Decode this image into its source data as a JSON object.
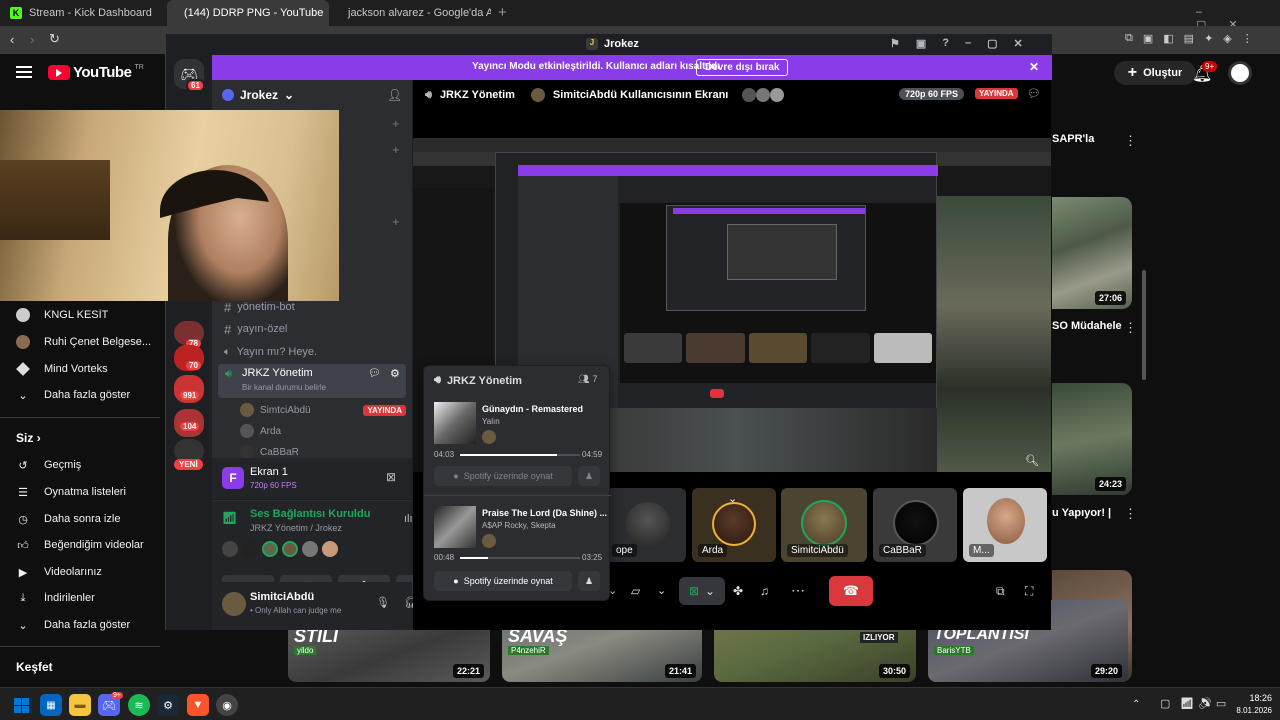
{
  "browser": {
    "tabs": [
      {
        "title": "Stream - Kick Dashboard",
        "favicon": "kick-icon",
        "color": "#53fc18"
      },
      {
        "title": "(144) DDRP PNG - YouTube",
        "favicon": "youtube-icon",
        "color": "#ff0033"
      },
      {
        "title": "jackson alvarez - Google'da Ara",
        "favicon": "google-icon",
        "color": "#4285f4"
      }
    ],
    "new_tab": "+"
  },
  "youtube": {
    "logo": "YouTube",
    "logo_region": "TR",
    "create_label": "Oluştur",
    "notifications": "9+",
    "sidebar": {
      "subscriptions": [
        {
          "label": "KNGL KESİT"
        },
        {
          "label": "Ruhi Çenet Belgese..."
        },
        {
          "label": "Mind Vorteks"
        }
      ],
      "show_more_1": "Daha fazla göster",
      "you_header": "Siz",
      "you_items": [
        {
          "label": "Geçmiş",
          "icon": "history-icon"
        },
        {
          "label": "Oynatma listeleri",
          "icon": "playlist-icon"
        },
        {
          "label": "Daha sonra izle",
          "icon": "clock-icon"
        },
        {
          "label": "Beğendiğim videolar",
          "icon": "thumbs-up-icon"
        },
        {
          "label": "Videolarınız",
          "icon": "play-square-icon"
        },
        {
          "label": "İndirilenler",
          "icon": "download-icon"
        }
      ],
      "show_more_2": "Daha fazla göster",
      "explore_header": "Keşfet"
    },
    "right_cards": {
      "title_1": "SAPR'la",
      "duration_1": "27:06",
      "title_2": "SO Müdahele",
      "duration_2": "24:23",
      "title_3": "u Yapıyor! |"
    },
    "bottom_videos": [
      {
        "title": "STILI",
        "channel": "yildo",
        "duration": "22:21"
      },
      {
        "title": "SAVAŞ",
        "channel": "P4nzehiR",
        "duration": "21:41"
      },
      {
        "title": "IZLIYOR",
        "channel": "",
        "duration": "30:50"
      },
      {
        "title": "TOPLANTISI",
        "channel": "BarisYTB",
        "duration": "29:20"
      }
    ]
  },
  "discord": {
    "window_title": "Jrokez",
    "server_badge": "61",
    "streamer_banner": "Yayıncı Modu etkinleştirildi. Kullanıcı adları kısaltıldı.",
    "streamer_button": "Devre dışı bırak",
    "server_name": "Jrokez",
    "server_badges": [
      "78",
      "70",
      "991",
      "104"
    ],
    "server_new": "YENİ",
    "channels": [
      {
        "name": "yönetim-bot",
        "type": "text"
      },
      {
        "name": "yayın-özel",
        "type": "text"
      },
      {
        "name": "Yayın mı? Heye.",
        "type": "voice"
      }
    ],
    "active_voice": {
      "name": "JRKZ Yönetim",
      "status": "Bir kanal durumu belirle"
    },
    "voice_users": [
      {
        "name": "SimtciAbdü",
        "badge": "YAYINDA"
      },
      {
        "name": "Arda"
      },
      {
        "name": "CaBBaR"
      }
    ],
    "stream_card": {
      "title": "Ekran 1",
      "quality": "720p 60 FPS"
    },
    "voice_status": {
      "title": "Ses Bağlantısı Kuruldu",
      "channel": "JRKZ Yönetim / Jrokez"
    },
    "user": {
      "name": "SimitciAbdü",
      "status": "• Only Allah can judge me"
    },
    "stage_header": {
      "channel": "JRKZ Yönetim",
      "screen": "SimitciAbdü Kullanıcısının Ekranı",
      "quality": "720p 60 FPS",
      "live": "YAYINDA"
    },
    "activity": {
      "channel": "JRKZ Yönetim",
      "count": "7",
      "tracks": [
        {
          "title": "Günaydın - Remastered",
          "artist": "Yalın",
          "elapsed": "04:03",
          "total": "04:59",
          "progress": 0.81,
          "button": "Spotify üzerinde oynat"
        },
        {
          "title": "Praise The Lord (Da Shine) ...",
          "artist": "A$AP Rocky, Skepta",
          "elapsed": "00:48",
          "total": "03:25",
          "progress": 0.23,
          "button": "Spotify üzerinde oynat"
        }
      ]
    },
    "participants": [
      {
        "name": "ope"
      },
      {
        "name": "Arda"
      },
      {
        "name": "SimitciAbdü"
      },
      {
        "name": "CaBBaR"
      },
      {
        "name": "M..."
      }
    ]
  },
  "taskbar": {
    "time": "18:26",
    "date": "8.01.2026",
    "discord_badge": "9+"
  }
}
